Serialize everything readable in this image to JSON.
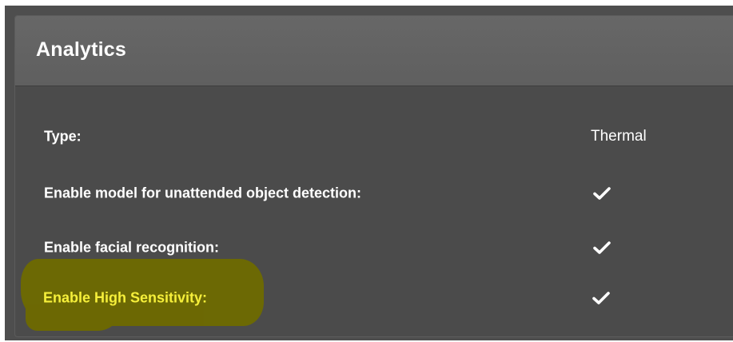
{
  "panel": {
    "title": "Analytics"
  },
  "rows": [
    {
      "label": "Type:",
      "value": "Thermal",
      "value_kind": "text",
      "highlighted": false
    },
    {
      "label": "Enable model for unattended object detection:",
      "value_kind": "check",
      "icon": "checkmark-icon",
      "highlighted": false
    },
    {
      "label": "Enable facial recognition:",
      "value_kind": "check",
      "icon": "checkmark-icon",
      "highlighted": false
    },
    {
      "label": "Enable High Sensitivity:",
      "value_kind": "check",
      "icon": "checkmark-icon",
      "highlighted": true
    }
  ],
  "colors": {
    "panel_bg": "#4b4b4b",
    "header_bg": "#666666",
    "text": "#ffffff",
    "highlight_text": "#f6ef3a",
    "highlight_marker": "#6e6a00"
  }
}
